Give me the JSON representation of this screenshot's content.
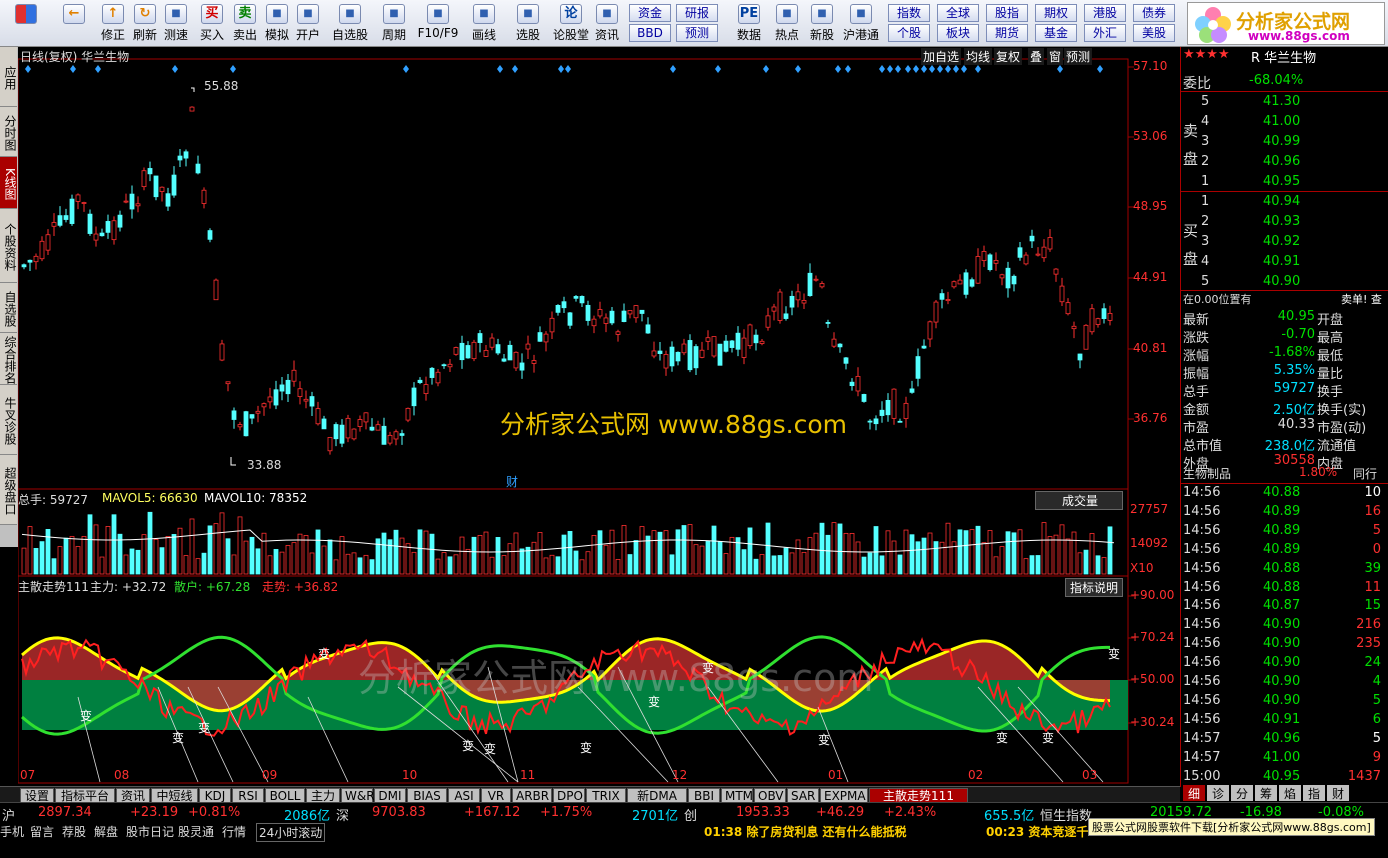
{
  "toolbar": {
    "buttons": [
      {
        "label": "",
        "icon": "stock-grid-icon"
      },
      {
        "label": "",
        "icon": "back-arrow-icon"
      },
      {
        "label": "修正",
        "icon": "up-arrow-icon"
      },
      {
        "label": "刷新",
        "icon": "refresh-icon"
      },
      {
        "label": "测速",
        "icon": "clock-icon"
      },
      {
        "label": "买入",
        "icon": "buy-icon",
        "glyph": "买"
      },
      {
        "label": "卖出",
        "icon": "sell-icon",
        "glyph": "卖"
      },
      {
        "label": "模拟",
        "icon": "hammer-icon"
      },
      {
        "label": "开户",
        "icon": "lock-icon"
      },
      {
        "label": "自选股",
        "icon": "star-folder-icon"
      },
      {
        "label": "周期",
        "icon": "clock-cycle-icon"
      },
      {
        "label": "F10/F9",
        "icon": "f10-icon"
      },
      {
        "label": "画线",
        "icon": "pencil-icon"
      },
      {
        "label": "选股",
        "icon": "monitor-icon"
      },
      {
        "label": "论股堂",
        "icon": "lun-icon",
        "glyph": "论"
      },
      {
        "label": "资讯",
        "icon": "document-icon"
      },
      {
        "label": "数据",
        "icon": "pe-icon",
        "glyph": "PE"
      },
      {
        "label": "热点",
        "icon": "hot-icon"
      },
      {
        "label": "新股",
        "icon": "ipo-icon"
      },
      {
        "label": "沪港通",
        "icon": "sse-hkex-icon"
      }
    ],
    "small": [
      "资金",
      "研报",
      "BBD",
      "预测",
      "指数",
      "全球",
      "股指",
      "期权",
      "港股",
      "债券",
      "个股",
      "板块",
      "期货",
      "基金",
      "外汇",
      "美股"
    ]
  },
  "logo": {
    "title": "分析家公式网",
    "url": "www.88gs.com"
  },
  "sidetabs": [
    "应用",
    "分时图",
    "K线图",
    "个股资料",
    "自选股",
    "综合排名",
    "牛叉诊股",
    "超级盘口"
  ],
  "chart_header": {
    "title": "日线(复权) 华兰生物",
    "menu": [
      "加自选",
      "均线",
      "复权",
      "叠",
      "窗",
      "预测"
    ]
  },
  "price_axis": [
    "57.10",
    "53.06",
    "48.95",
    "44.91",
    "40.81",
    "36.76"
  ],
  "annotations": {
    "high": "55.88",
    "low": "33.88",
    "cai": "财",
    "watermark": "分析家公式网  www.88gs.com",
    "watermark2": "分析家公式网www.88gs.com"
  },
  "volume": {
    "label_total": "总手: 59727",
    "ma5": "MAVOL5: 66630",
    "ma10": "MAVOL10: 78352",
    "dropdown": "成交量",
    "axis": [
      "27757",
      "14092",
      "X10"
    ]
  },
  "indicator": {
    "name": "主散走势111",
    "main": "主力: +32.72",
    "retail": "散户: +67.28",
    "trend": "走势: +36.82",
    "help": "指标说明",
    "axis": [
      "+90.00",
      "+70.24",
      "+50.00",
      "+30.24"
    ],
    "change_label": "变"
  },
  "months": [
    "07",
    "08",
    "09",
    "10",
    "11",
    "12",
    "01",
    "02",
    "03"
  ],
  "tabs": [
    "设置",
    "指标平台",
    "资讯",
    "中短线",
    "KDJ",
    "RSI",
    "BOLL",
    "主力",
    "W&R",
    "DMI",
    "BIAS",
    "ASI",
    "VR",
    "ARBR",
    "DPO",
    "TRIX",
    "新DMA",
    "BBI",
    "MTM",
    "OBV",
    "SAR",
    "EXPMA",
    "主散走势111"
  ],
  "quote": {
    "header": "R 华兰生物",
    "stars": "★★★★",
    "ratio_label": "委比",
    "ratio": "-68.04%",
    "sell_label": "卖盘",
    "buy_label": "买盘",
    "sell": [
      {
        "n": "5",
        "p": "41.30"
      },
      {
        "n": "4",
        "p": "41.00"
      },
      {
        "n": "3",
        "p": "40.99"
      },
      {
        "n": "2",
        "p": "40.96"
      },
      {
        "n": "1",
        "p": "40.95"
      }
    ],
    "buy": [
      {
        "n": "1",
        "p": "40.94"
      },
      {
        "n": "2",
        "p": "40.93"
      },
      {
        "n": "3",
        "p": "40.92"
      },
      {
        "n": "4",
        "p": "40.91"
      },
      {
        "n": "5",
        "p": "40.90"
      }
    ],
    "position": "在0.00位置有",
    "sell_single": "卖单! 查",
    "stats": [
      {
        "k": "最新",
        "v": "40.95",
        "k2": "开盘",
        "c": "#00e000"
      },
      {
        "k": "涨跌",
        "v": "-0.70",
        "k2": "最高",
        "c": "#00e000"
      },
      {
        "k": "涨幅",
        "v": "-1.68%",
        "k2": "最低",
        "c": "#00e000"
      },
      {
        "k": "振幅",
        "v": "5.35%",
        "k2": "量比",
        "c": "#00e0ff"
      },
      {
        "k": "总手",
        "v": "59727",
        "k2": "换手",
        "c": "#00e0ff"
      },
      {
        "k": "金额",
        "v": "2.50亿",
        "k2": "换手(实)",
        "c": "#00e0ff"
      },
      {
        "k": "市盈",
        "v": "40.33",
        "k2": "市盈(动)",
        "c": "#ddd"
      },
      {
        "k": "总市值",
        "v": "238.0亿",
        "k2": "流通值",
        "c": "#00e0ff"
      },
      {
        "k": "外盘",
        "v": "30558",
        "k2": "内盘",
        "c": "#ff3030"
      }
    ],
    "sector": "生物制品",
    "sector_pct": "1.80%",
    "same": "同行",
    "ticks": [
      {
        "t": "14:56",
        "p": "40.88",
        "v": "10",
        "c": "#fff"
      },
      {
        "t": "14:56",
        "p": "40.89",
        "v": "16",
        "c": "#ff3030"
      },
      {
        "t": "14:56",
        "p": "40.89",
        "v": "5",
        "c": "#ff3030"
      },
      {
        "t": "14:56",
        "p": "40.89",
        "v": "0",
        "c": "#ff3030"
      },
      {
        "t": "14:56",
        "p": "40.88",
        "v": "39",
        "c": "#00e000"
      },
      {
        "t": "14:56",
        "p": "40.88",
        "v": "11",
        "c": "#ff3030"
      },
      {
        "t": "14:56",
        "p": "40.87",
        "v": "15",
        "c": "#00e000"
      },
      {
        "t": "14:56",
        "p": "40.90",
        "v": "216",
        "c": "#ff3030"
      },
      {
        "t": "14:56",
        "p": "40.90",
        "v": "235",
        "c": "#ff3030"
      },
      {
        "t": "14:56",
        "p": "40.90",
        "v": "24",
        "c": "#00e000"
      },
      {
        "t": "14:56",
        "p": "40.90",
        "v": "4",
        "c": "#00e000"
      },
      {
        "t": "14:56",
        "p": "40.90",
        "v": "5",
        "c": "#00e000"
      },
      {
        "t": "14:56",
        "p": "40.91",
        "v": "6",
        "c": "#00e000"
      },
      {
        "t": "14:57",
        "p": "40.96",
        "v": "5",
        "c": "#fff"
      },
      {
        "t": "14:57",
        "p": "41.00",
        "v": "9",
        "c": "#ff3030"
      },
      {
        "t": "15:00",
        "p": "40.95",
        "v": "1437",
        "c": "#ff3030"
      }
    ],
    "bottom_tabs": [
      "细",
      "诊",
      "分",
      "筹",
      "焰",
      "指",
      "财"
    ]
  },
  "status1": {
    "sh": "沪",
    "sh_v": "2897.34",
    "sh_c": "+23.19",
    "sh_p": "+0.81%",
    "sh_amt": "2086亿",
    "sz": "深",
    "sz_v": "9703.83",
    "sz_c": "+167.12",
    "sz_p": "+1.75%",
    "sz_amt": "2701亿",
    "cy": "创",
    "cy_v": "1953.33",
    "cy_c": "+46.29",
    "cy_p": "+2.43%",
    "cy_amt": "655.5亿",
    "hs": "恒生指数",
    "hs_v": "20159.72",
    "hs_c": "-16.98",
    "hs_p": "-0.08%"
  },
  "status2": {
    "items": [
      "手机",
      "留言",
      "荐股",
      "解盘",
      "股市日记",
      "股灵通",
      "行情",
      "24小时滚动"
    ],
    "news1": "01:38 除了房贷利息 还有什么能抵税",
    "news2": "00:23 资本竞逐千",
    "promo": "股票公式网股票软件下载[分析家公式网www.88gs.com]"
  }
}
